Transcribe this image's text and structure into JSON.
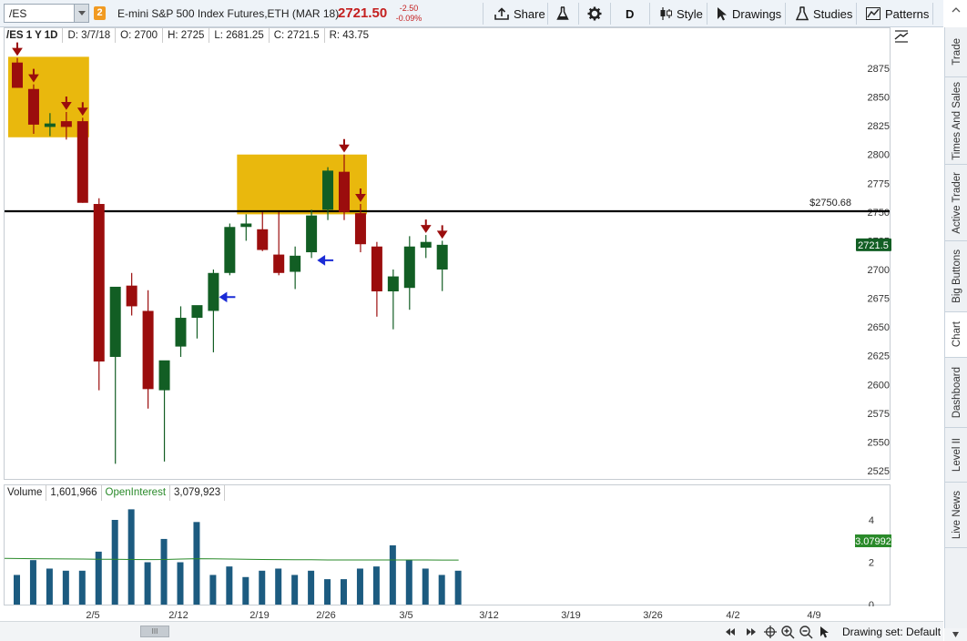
{
  "toolbar": {
    "symbol": "/ES",
    "link_badge": "2",
    "instrument": "E-mini S&P 500 Index Futures,ETH (MAR 18)",
    "last_price": "2721.50",
    "change": "-2.50",
    "change_pct": "-0.09%",
    "share": "Share",
    "aggregation": "D",
    "style": "Style",
    "drawings": "Drawings",
    "studies": "Studies",
    "patterns": "Patterns"
  },
  "infobar": {
    "symbol": "/ES 1 Y 1D",
    "date": "D: 3/7/18",
    "open": "O: 2700",
    "high": "H: 2725",
    "low": "L: 2681.25",
    "close": "C: 2721.5",
    "range": "R: 43.75"
  },
  "volume_info": {
    "label": "Volume",
    "volume": "1,601,966",
    "oi_label": "OpenInterest",
    "oi_value": "3,079,923"
  },
  "price_axis": {
    "ticks": [
      "2875",
      "2850",
      "2825",
      "2800",
      "2775",
      "2750",
      "2725",
      "2700",
      "2675",
      "2650",
      "2625",
      "2600",
      "2575",
      "2550",
      "2525"
    ],
    "current_label": "2721.5"
  },
  "volume_axis": {
    "ticks": [
      "4",
      "2",
      "0"
    ],
    "current_label": "3.07992",
    "unit": "<millions>"
  },
  "date_axis": [
    "2/5",
    "2/12",
    "2/19",
    "2/26",
    "3/5",
    "3/12",
    "3/19",
    "3/26",
    "4/2",
    "4/9"
  ],
  "hline": {
    "value": 2750.68,
    "label": "$2750.68"
  },
  "bottom": {
    "drawing_set": "Drawing set: Default",
    "scroll_label": "III"
  },
  "sidebar_tabs": [
    "Trade",
    "Times And Sales",
    "Active Trader",
    "Big Buttons",
    "Chart",
    "Dashboard",
    "Level II",
    "Live News"
  ],
  "colors": {
    "up": "#125e24",
    "down": "#9b0d0d",
    "highlight": "#e8b400",
    "volume": "#1c5b80",
    "oi": "#2a8a2a",
    "arrow_down": "#9b0d0d",
    "arrow_left": "#1a2bd6"
  },
  "chart_data": {
    "type": "candlestick",
    "y_range": [
      2510,
      2890
    ],
    "candles": [
      {
        "o": 2880,
        "h": 2884,
        "l": 2858,
        "c": 2858
      },
      {
        "o": 2857,
        "h": 2861,
        "l": 2818,
        "c": 2826
      },
      {
        "o": 2824,
        "h": 2836,
        "l": 2816,
        "c": 2827
      },
      {
        "o": 2829,
        "h": 2837,
        "l": 2813,
        "c": 2824
      },
      {
        "o": 2829,
        "h": 2832,
        "l": 2758,
        "c": 2758
      },
      {
        "o": 2757,
        "h": 2762,
        "l": 2595,
        "c": 2620
      },
      {
        "o": 2624,
        "h": 2680,
        "l": 2531,
        "c": 2685
      },
      {
        "o": 2686,
        "h": 2697,
        "l": 2660,
        "c": 2668
      },
      {
        "o": 2664,
        "h": 2682,
        "l": 2579,
        "c": 2596
      },
      {
        "o": 2595,
        "h": 2614,
        "l": 2533,
        "c": 2621
      },
      {
        "o": 2633,
        "h": 2668,
        "l": 2624,
        "c": 2658
      },
      {
        "o": 2658,
        "h": 2664,
        "l": 2640,
        "c": 2669
      },
      {
        "o": 2664,
        "h": 2700,
        "l": 2628,
        "c": 2697
      },
      {
        "o": 2697,
        "h": 2740,
        "l": 2695,
        "c": 2737
      },
      {
        "o": 2737,
        "h": 2748,
        "l": 2725,
        "c": 2740
      },
      {
        "o": 2735,
        "h": 2750,
        "l": 2716,
        "c": 2717
      },
      {
        "o": 2713,
        "h": 2750,
        "l": 2695,
        "c": 2697
      },
      {
        "o": 2698,
        "h": 2720,
        "l": 2683,
        "c": 2712
      },
      {
        "o": 2715,
        "h": 2752,
        "l": 2710,
        "c": 2747
      },
      {
        "o": 2752,
        "h": 2789,
        "l": 2743,
        "c": 2786
      },
      {
        "o": 2785,
        "h": 2800,
        "l": 2743,
        "c": 2750
      },
      {
        "o": 2749,
        "h": 2757,
        "l": 2715,
        "c": 2722
      },
      {
        "o": 2720,
        "h": 2724,
        "l": 2659,
        "c": 2681
      },
      {
        "o": 2681,
        "h": 2700,
        "l": 2648,
        "c": 2694
      },
      {
        "o": 2684,
        "h": 2729,
        "l": 2665,
        "c": 2720
      },
      {
        "o": 2719,
        "h": 2730,
        "l": 2710,
        "c": 2724
      },
      {
        "o": 2700,
        "h": 2725,
        "l": 2681.25,
        "c": 2721.5
      }
    ],
    "volume_millions": [
      1.4,
      2.1,
      1.7,
      1.6,
      1.6,
      2.5,
      4.0,
      4.5,
      2.0,
      3.1,
      2.0,
      3.9,
      1.4,
      1.8,
      1.3,
      1.6,
      1.7,
      1.4,
      1.6,
      1.2,
      1.2,
      1.7,
      1.8,
      2.8,
      2.1,
      1.7,
      1.4,
      1.6
    ],
    "open_interest_millions": [
      3.2,
      3.18,
      3.17,
      3.16,
      3.15,
      3.14,
      3.13,
      3.12,
      3.11,
      3.12,
      3.15,
      3.18,
      3.17,
      3.15,
      3.13,
      3.12,
      3.11,
      3.1,
      3.1,
      3.09,
      3.09,
      3.09,
      3.09,
      3.09,
      3.09,
      3.085,
      3.08,
      3.08
    ],
    "down_arrows_at": [
      0,
      1,
      3,
      4,
      20,
      21,
      25,
      26
    ],
    "left_arrows_at": [
      {
        "i": 12,
        "v": 2676
      },
      {
        "i": 18,
        "v": 2708
      }
    ],
    "highlight_boxes": [
      {
        "from": 0,
        "to": 4,
        "top": 2885,
        "bottom": 2815
      },
      {
        "from": 14,
        "to": 21,
        "top": 2800,
        "bottom": 2748
      }
    ],
    "volume_range": [
      0,
      5
    ]
  }
}
